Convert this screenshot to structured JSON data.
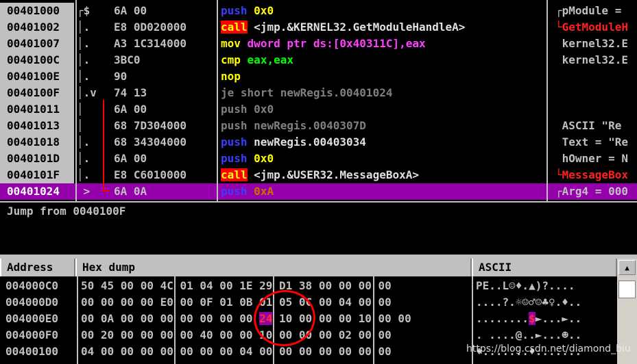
{
  "disasm": [
    {
      "addr": "00401000",
      "arrow": "┌$",
      "hex": "6A 00",
      "ins": "push",
      "args": "0x0",
      "ins_cls": "k-push",
      "arg_cls": "k-yellowarg",
      "cmt": "┌pModule =",
      "cmt_cls": ""
    },
    {
      "addr": "00401002",
      "arrow": "│.",
      "hex": "E8 0D020000",
      "ins": "call",
      "args": "<jmp.&KERNEL32.GetModuleHandleA>",
      "ins_cls": "k-call",
      "arg_cls": "k-arg-white",
      "cmt": "└GetModuleH",
      "cmt_cls": "cmt-red"
    },
    {
      "addr": "00401007",
      "arrow": "│.",
      "hex": "A3 1C314000",
      "ins": "mov",
      "args": "dword ptr ds:[0x40311C],eax",
      "ins_cls": "k-mov",
      "arg_cls": "k-arg-pink",
      "cmt": " kernel32.E",
      "cmt_cls": ""
    },
    {
      "addr": "0040100C",
      "arrow": "│.",
      "hex": "3BC0",
      "ins": "cmp",
      "args": "eax,eax",
      "ins_cls": "k-cmp",
      "arg_cls": "k-arg-green",
      "cmt": " kernel32.E",
      "cmt_cls": ""
    },
    {
      "addr": "0040100E",
      "arrow": "│.",
      "hex": "90",
      "ins": "nop",
      "args": "",
      "ins_cls": "k-nop",
      "arg_cls": "",
      "cmt": "",
      "cmt_cls": ""
    },
    {
      "addr": "0040100F",
      "arrow": "│.v",
      "hex": "74 13",
      "ins": "je short",
      "args": "newRegis.00401024",
      "ins_cls": "k-jcc",
      "arg_cls": "k-jccarg",
      "cmt": "",
      "cmt_cls": ""
    },
    {
      "addr": "00401011",
      "arrow": "│ ",
      "hex": "6A 00",
      "ins": "push",
      "args": "0x0",
      "ins_cls": "k-jcc",
      "arg_cls": "k-greyarg",
      "cmt": "",
      "cmt_cls": ""
    },
    {
      "addr": "00401013",
      "arrow": "│ ",
      "hex": "68 7D304000",
      "ins": "push",
      "args": "newRegis.0040307D",
      "ins_cls": "k-jcc",
      "arg_cls": "k-greyarg",
      "cmt": " ASCII \"Re",
      "cmt_cls": ""
    },
    {
      "addr": "00401018",
      "arrow": "│.",
      "hex": "68 34304000",
      "ins": "push",
      "args": "newRegis.00403034",
      "ins_cls": "k-push",
      "arg_cls": "k-arg-white",
      "cmt": " Text = \"Re",
      "cmt_cls": ""
    },
    {
      "addr": "0040101D",
      "arrow": "│.",
      "hex": "6A 00",
      "ins": "push",
      "args": "0x0",
      "ins_cls": "k-push",
      "arg_cls": "k-yellowarg",
      "cmt": " hOwner = N",
      "cmt_cls": ""
    },
    {
      "addr": "0040101F",
      "arrow": "│.",
      "hex": "E8 C6010000",
      "ins": "call",
      "args": "<jmp.&USER32.MessageBoxA>",
      "ins_cls": "k-call",
      "arg_cls": "k-arg-white",
      "cmt": "└MessageBox",
      "cmt_cls": "cmt-red"
    },
    {
      "addr": "00401024",
      "arrow": " >",
      "hex": "6A 0A",
      "ins": "push",
      "args": "0xA",
      "ins_cls": "k-push",
      "arg_cls": "k-yellowarg",
      "cmt": "┌Arg4 = 000",
      "cmt_cls": "",
      "selected": true
    }
  ],
  "info": {
    "text": "Jump from 0040100F"
  },
  "dump": {
    "headers": {
      "address": "Address",
      "hex": "Hex dump",
      "ascii": "ASCII"
    },
    "rows": [
      {
        "addr": "004000C0",
        "g1": "50 45 00 00",
        "g2": "4C 01 04 00",
        "g3": "1E 29 D1 38",
        "g4": "00 00 00 00",
        "ascii": "PE..L☺♦.▲)?...."
      },
      {
        "addr": "004000D0",
        "g1": "00 00 00 00",
        "g2": "E0 00 0F 01",
        "g3": "0B 01 05 0C",
        "g4": "00 04 00 00",
        "ascii": "....?.☼☺♂☺♣♀.♦.."
      },
      {
        "addr": "004000E0",
        "g1": "00 0A 00 00",
        "g2": "00 00 00 00",
        "g3a": "00 ",
        "g3hi": "24",
        "g3b": " 10 00 00",
        "g4": "00 10 00 00",
        "ascii_a": "........",
        "ascii_hi": "$",
        "ascii_b": "►...►.."
      },
      {
        "addr": "004000F0",
        "g1": "00 20 00 00",
        "g2": "00 00 40 00",
        "g3": "00 10 00 00",
        "g4": "00 02 00 00",
        "ascii": ". ....@..►...☻.."
      },
      {
        "addr": "00400100",
        "g1": "04 00 00 00",
        "g2": "00 00 00 00",
        "g3": "04 00 00 00",
        "g4": "00 00 00 00",
        "ascii": "♦.......♦......."
      }
    ]
  },
  "watermark": "https://blog.csdn.net/diamond_biu"
}
